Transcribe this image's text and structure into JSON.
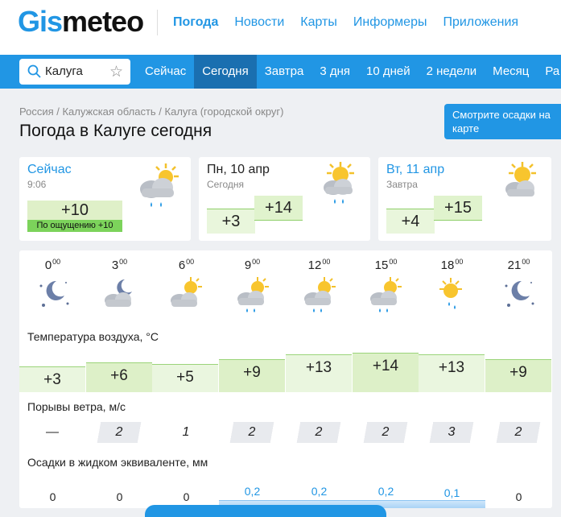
{
  "header": {
    "logo_g": "Gis",
    "logo_rest": "meteo",
    "nav": [
      "Погода",
      "Новости",
      "Карты",
      "Информеры",
      "Приложения"
    ]
  },
  "search": {
    "value": "Калуга"
  },
  "tabs": [
    "Сейчас",
    "Сегодня",
    "Завтра",
    "3 дня",
    "10 дней",
    "2 недели",
    "Месяц",
    "Ра"
  ],
  "breadcrumb": "Россия / Калужская область / Калуга (городской округ)",
  "title": "Погода в Калуге сегодня",
  "map_button": "Смотрите осадки на карте",
  "cards": {
    "now": {
      "label": "Сейчас",
      "time": "9:06",
      "temp": "+10",
      "feels": "По ощущению +10"
    },
    "today": {
      "label": "Пн, 10 апр",
      "sub": "Сегодня",
      "min": "+3",
      "max": "+14"
    },
    "tomorrow": {
      "label": "Вт, 11 апр",
      "sub": "Завтра",
      "min": "+4",
      "max": "+15"
    }
  },
  "hourly": {
    "hours": [
      {
        "h": "0",
        "m": "00"
      },
      {
        "h": "3",
        "m": "00"
      },
      {
        "h": "6",
        "m": "00"
      },
      {
        "h": "9",
        "m": "00"
      },
      {
        "h": "12",
        "m": "00"
      },
      {
        "h": "15",
        "m": "00"
      },
      {
        "h": "18",
        "m": "00"
      },
      {
        "h": "21",
        "m": "00"
      }
    ],
    "icons": [
      "night-clear-icon",
      "night-cloudy-icon",
      "partly-cloudy-icon",
      "partly-cloudy-rain-icon",
      "partly-cloudy-rain-icon",
      "partly-cloudy-rain-icon",
      "sun-rain-icon",
      "night-clear-icon"
    ],
    "temp_label": "Температура воздуха, °C",
    "temps": [
      "+3",
      "+6",
      "+5",
      "+9",
      "+13",
      "+14",
      "+13",
      "+9"
    ],
    "temp_values": [
      3,
      6,
      5,
      9,
      13,
      14,
      13,
      9
    ],
    "wind_label": "Порывы ветра, м/с",
    "wind": [
      "—",
      "2",
      "1",
      "2",
      "2",
      "2",
      "3",
      "2"
    ],
    "precip_label": "Осадки в жидком эквиваленте, мм",
    "precip": [
      "0",
      "0",
      "0",
      "0,2",
      "0,2",
      "0,2",
      "0,1",
      "0"
    ],
    "precip_values": [
      0,
      0,
      0,
      0.2,
      0.2,
      0.2,
      0.1,
      0
    ]
  },
  "colors": {
    "accent": "#2196e4",
    "temp_fill": "#e2f3d0",
    "feels_fill": "#7cd35b"
  }
}
